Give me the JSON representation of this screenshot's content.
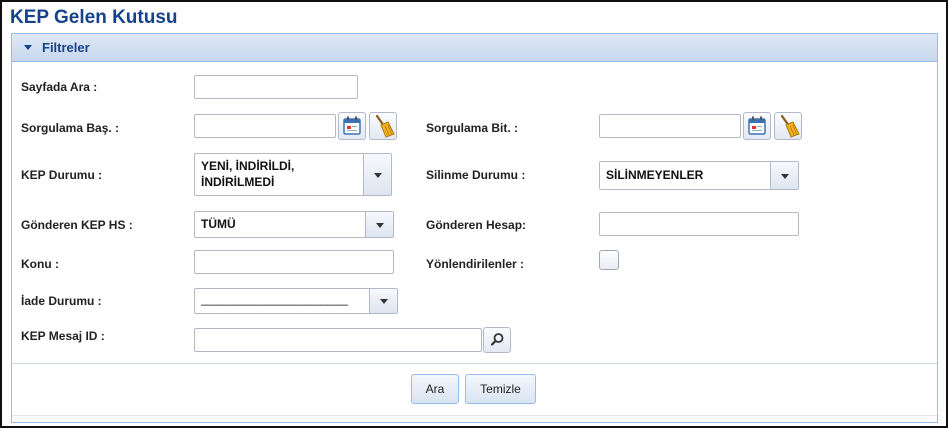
{
  "page": {
    "title": "KEP Gelen Kutusu"
  },
  "filter_panel": {
    "title": "Filtreler",
    "collapsed": false
  },
  "fields": {
    "sayfada_ara": {
      "label": "Sayfada Ara :",
      "value": ""
    },
    "sorgulama_bas": {
      "label": "Sorgulama Baş. :",
      "value": ""
    },
    "sorgulama_bit": {
      "label": "Sorgulama Bit. :",
      "value": ""
    },
    "kep_durumu": {
      "label": "KEP Durumu :",
      "value_line1": "YENİ, İNDİRİLDİ,",
      "value_line2": "İNDİRİLMEDİ"
    },
    "silinme_durumu": {
      "label": "Silinme Durumu :",
      "value": "SİLİNMEYENLER"
    },
    "gonderen_kep_hs": {
      "label": "Gönderen KEP HS :",
      "value": "TÜMÜ"
    },
    "gonderen_hesap": {
      "label": "Gönderen Hesap:",
      "value": ""
    },
    "konu": {
      "label": "Konu :",
      "value": ""
    },
    "yonlendirilenler": {
      "label": "Yönlendirilenler :",
      "checked": false
    },
    "iade_durumu": {
      "label": "İade Durumu :",
      "value": "______________________"
    },
    "kep_mesaj_id": {
      "label": "KEP Mesaj ID :",
      "value": ""
    }
  },
  "buttons": {
    "search": "Ara",
    "clear": "Temizle"
  },
  "icons": {
    "calendar": "calendar-icon",
    "clear": "broom-icon",
    "search": "magnifier-icon",
    "collapse": "caret-down-icon",
    "dropdown": "chevron-down-icon"
  },
  "colors": {
    "title": "#15428b",
    "panel_border": "#99bbe8",
    "header_bg": "#dfe8f6"
  }
}
